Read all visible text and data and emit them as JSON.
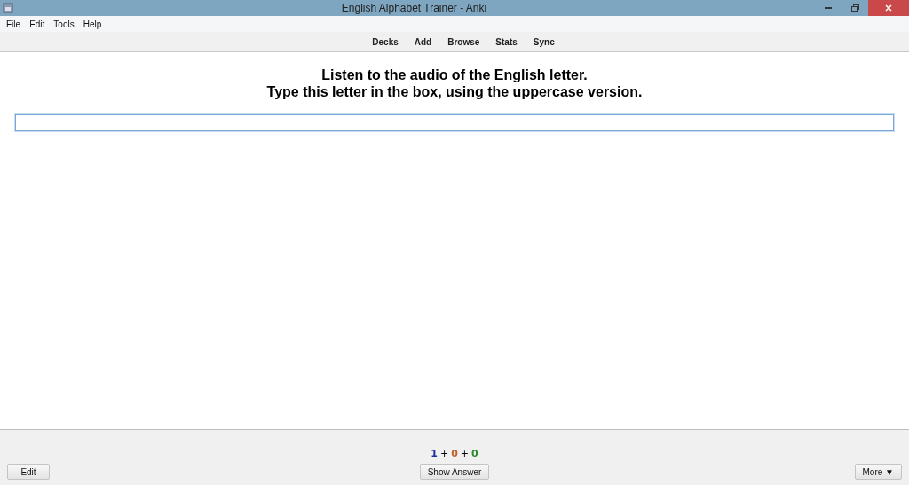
{
  "window": {
    "title": "English Alphabet Trainer - Anki"
  },
  "menu": [
    "File",
    "Edit",
    "Tools",
    "Help"
  ],
  "toolbar": [
    "Decks",
    "Add",
    "Browse",
    "Stats",
    "Sync"
  ],
  "card": {
    "lines": [
      "Listen to the audio of the English letter.",
      "Type this letter in the box, using the uppercase version."
    ]
  },
  "counts": [
    {
      "kind": "count",
      "text": "1",
      "color": "#1a2ea0",
      "selected": true
    },
    {
      "kind": "separator",
      "text": "+"
    },
    {
      "kind": "count",
      "text": "0",
      "color": "#c0602a",
      "selected": false
    },
    {
      "kind": "separator",
      "text": "+"
    },
    {
      "kind": "count",
      "text": "0",
      "color": "#2a8a2a",
      "selected": false
    }
  ],
  "buttons": {
    "edit": "Edit",
    "show_answer": "Show Answer",
    "more": "More ▼"
  }
}
